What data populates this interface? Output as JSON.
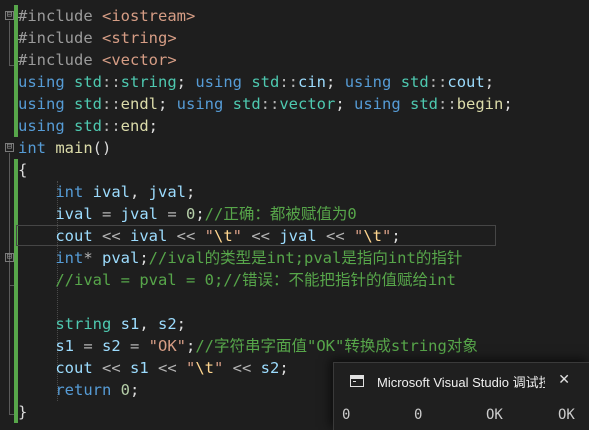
{
  "code_lines": [
    [
      [
        "pp",
        "#include "
      ],
      [
        "st",
        "<iostream>"
      ]
    ],
    [
      [
        "pp",
        "#include "
      ],
      [
        "st",
        "<string>"
      ]
    ],
    [
      [
        "pp",
        "#include "
      ],
      [
        "st",
        "<vector>"
      ]
    ],
    [
      [
        "kw",
        "using "
      ],
      [
        "ty",
        "std"
      ],
      [
        "op",
        "::"
      ],
      [
        "ty",
        "string"
      ],
      [
        "pl",
        "; "
      ],
      [
        "kw",
        "using "
      ],
      [
        "ty",
        "std"
      ],
      [
        "op",
        "::"
      ],
      [
        "vr",
        "cin"
      ],
      [
        "pl",
        "; "
      ],
      [
        "kw",
        "using "
      ],
      [
        "ty",
        "std"
      ],
      [
        "op",
        "::"
      ],
      [
        "vr",
        "cout"
      ],
      [
        "pl",
        ";"
      ]
    ],
    [
      [
        "kw",
        "using "
      ],
      [
        "ty",
        "std"
      ],
      [
        "op",
        "::"
      ],
      [
        "fn",
        "endl"
      ],
      [
        "pl",
        "; "
      ],
      [
        "kw",
        "using "
      ],
      [
        "ty",
        "std"
      ],
      [
        "op",
        "::"
      ],
      [
        "ty",
        "vector"
      ],
      [
        "pl",
        "; "
      ],
      [
        "kw",
        "using "
      ],
      [
        "ty",
        "std"
      ],
      [
        "op",
        "::"
      ],
      [
        "fn",
        "begin"
      ],
      [
        "pl",
        ";"
      ]
    ],
    [
      [
        "kw",
        "using "
      ],
      [
        "ty",
        "std"
      ],
      [
        "op",
        "::"
      ],
      [
        "fn",
        "end"
      ],
      [
        "pl",
        ";"
      ]
    ],
    [
      [
        "kw",
        "int "
      ],
      [
        "fn",
        "main"
      ],
      [
        "pl",
        "()"
      ]
    ],
    [
      [
        "pl",
        "{"
      ]
    ],
    [
      [
        "pl",
        "    "
      ],
      [
        "kw",
        "int "
      ],
      [
        "vr",
        "ival"
      ],
      [
        "pl",
        ", "
      ],
      [
        "vr",
        "jval"
      ],
      [
        "pl",
        ";"
      ]
    ],
    [
      [
        "pl",
        "    "
      ],
      [
        "vr",
        "ival"
      ],
      [
        "op",
        " = "
      ],
      [
        "vr",
        "jval"
      ],
      [
        "op",
        " = "
      ],
      [
        "nm",
        "0"
      ],
      [
        "pl",
        ";"
      ],
      [
        "cm",
        "//正确：都被赋值为0"
      ]
    ],
    [
      [
        "pl",
        "    "
      ],
      [
        "vr",
        "cout"
      ],
      [
        "op",
        " << "
      ],
      [
        "vr",
        "ival"
      ],
      [
        "op",
        " << "
      ],
      [
        "st",
        "\""
      ],
      [
        "es",
        "\\t"
      ],
      [
        "st",
        "\""
      ],
      [
        "op",
        " << "
      ],
      [
        "vr",
        "jval"
      ],
      [
        "op",
        " << "
      ],
      [
        "st",
        "\""
      ],
      [
        "es",
        "\\t"
      ],
      [
        "st",
        "\""
      ],
      [
        "pl",
        ";"
      ]
    ],
    [
      [
        "pl",
        "    "
      ],
      [
        "kw",
        "int"
      ],
      [
        "op",
        "* "
      ],
      [
        "vr",
        "pval"
      ],
      [
        "pl",
        ";"
      ],
      [
        "cm",
        "//ival的类型是int;pval是指向int的指针"
      ]
    ],
    [
      [
        "pl",
        "    "
      ],
      [
        "cm",
        "//ival = pval = 0;//错误：不能把指针的值赋给int"
      ]
    ],
    [],
    [
      [
        "pl",
        "    "
      ],
      [
        "ty",
        "string "
      ],
      [
        "vr",
        "s1"
      ],
      [
        "pl",
        ", "
      ],
      [
        "vr",
        "s2"
      ],
      [
        "pl",
        ";"
      ]
    ],
    [
      [
        "pl",
        "    "
      ],
      [
        "vr",
        "s1"
      ],
      [
        "op",
        " = "
      ],
      [
        "vr",
        "s2"
      ],
      [
        "op",
        " = "
      ],
      [
        "st",
        "\"OK\""
      ],
      [
        "pl",
        ";"
      ],
      [
        "cm",
        "//字符串字面值\"OK\"转换成string对象"
      ]
    ],
    [
      [
        "pl",
        "    "
      ],
      [
        "vr",
        "cout"
      ],
      [
        "op",
        " << "
      ],
      [
        "vr",
        "s1"
      ],
      [
        "op",
        " << "
      ],
      [
        "st",
        "\""
      ],
      [
        "es",
        "\\t"
      ],
      [
        "st",
        "\""
      ],
      [
        "op",
        " << "
      ],
      [
        "vr",
        "s2"
      ],
      [
        "pl",
        ";"
      ]
    ],
    [
      [
        "pl",
        "    "
      ],
      [
        "kw",
        "return "
      ],
      [
        "nm",
        "0"
      ],
      [
        "pl",
        ";"
      ]
    ],
    [
      [
        "pl",
        "}"
      ]
    ]
  ],
  "gutter": {
    "fold_collapse_symbol": "⊟"
  },
  "debug_console": {
    "title": "Microsoft Visual Studio 调试控制台",
    "close_symbol": "✕",
    "output": [
      "0",
      "0",
      "OK",
      "OK"
    ]
  },
  "colors": {
    "background": "#1e1e1e",
    "keyword": "#569cd6",
    "type": "#4ec9b0",
    "function": "#dcdcaa",
    "variable": "#9cdcfe",
    "string": "#d69d85",
    "comment": "#57a64a",
    "number": "#b5cea8",
    "change_bar": "#57a64a"
  }
}
